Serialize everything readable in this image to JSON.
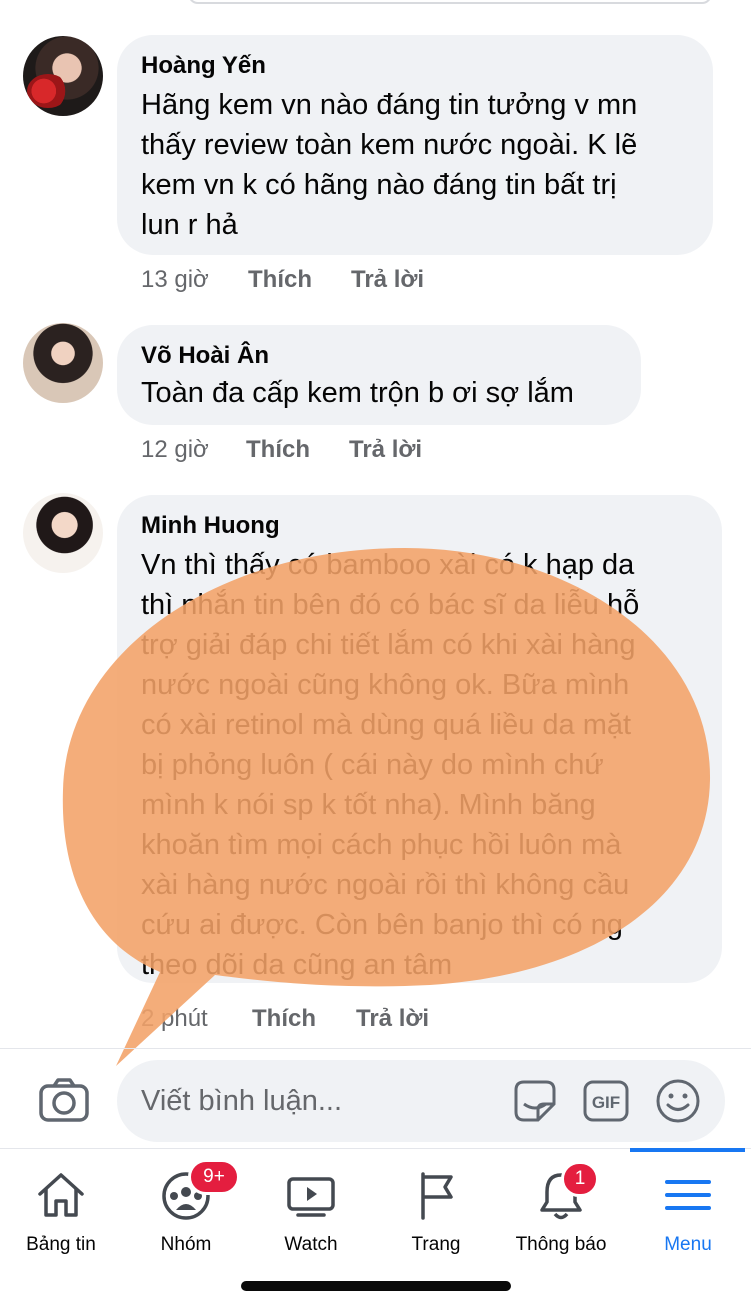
{
  "comments": [
    {
      "author": "Hoàng Yến",
      "lines": [
        "Hãng kem vn nào đáng tin tưởng v mn",
        "thấy review toàn kem nước ngoài. K lẽ",
        "kem vn k có hãng nào đáng tin bất trị",
        "lun r hả"
      ],
      "time": "13 giờ",
      "like_label": "Thích",
      "reply_label": "Trả lời"
    },
    {
      "author": "Võ Hoài Ân",
      "lines": [
        "Toàn đa cấp kem trộn b ơi sợ lắm"
      ],
      "time": "12 giờ",
      "like_label": "Thích",
      "reply_label": "Trả lời"
    },
    {
      "author": "Minh Huong",
      "lines": [
        "Vn thì thấy có bamboo xài có k hạp da",
        "thì nhắn tin bên đó có bác sĩ da liễu hỗ",
        "trợ giải đáp chi tiết lắm có khi xài hàng",
        "nước ngoài cũng không ok. Bữa mình",
        "có xài retinol mà dùng quá liều da mặt",
        "bị phỏng luôn ( cái này do mình chứ",
        "mình k nói sp k tốt nha). Mình băng",
        "khoăn tìm mọi cách phục hồi luôn mà",
        "xài hàng nước ngoài rồi thì không cầu",
        "cứu ai được. Còn bên banjo thì có ng",
        "theo dõi da cũng an tâm"
      ],
      "time": "2 phút",
      "like_label": "Thích",
      "reply_label": "Trả lời"
    }
  ],
  "composer": {
    "placeholder": "Viết bình luận...",
    "icons": [
      "camera-icon",
      "sticker-icon",
      "gif-icon",
      "emoji-icon"
    ],
    "gif_label": "GIF"
  },
  "tabs": [
    {
      "label": "Bảng tin",
      "icon": "home-icon"
    },
    {
      "label": "Nhóm",
      "icon": "groups-icon",
      "badge": "9+"
    },
    {
      "label": "Watch",
      "icon": "watch-icon"
    },
    {
      "label": "Trang",
      "icon": "flag-icon"
    },
    {
      "label": "Thông báo",
      "icon": "bell-icon",
      "badge": "1"
    },
    {
      "label": "Menu",
      "icon": "menu-icon",
      "active": true
    }
  ],
  "colors": {
    "bubble": "#f0f2f5",
    "accent": "#1877f2",
    "badge": "#e41e3f",
    "speech_overlay": "#f2a268",
    "meta_text": "#65676b"
  }
}
